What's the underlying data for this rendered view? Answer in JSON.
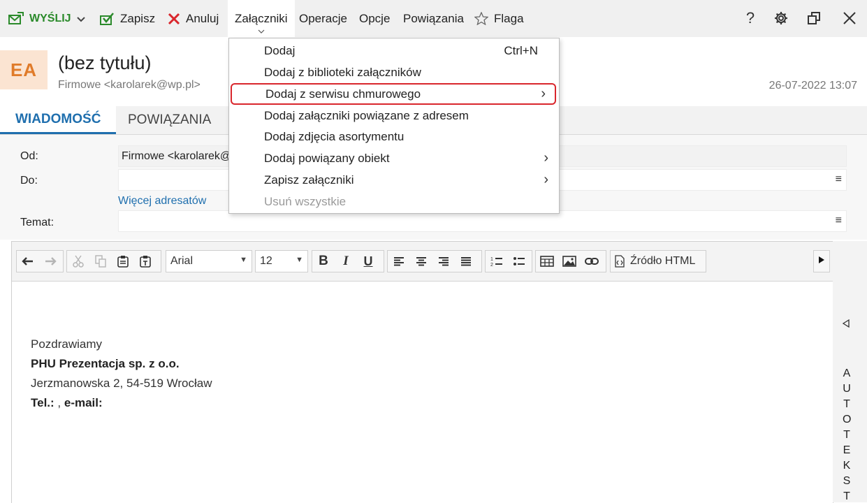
{
  "toolbar": {
    "send_label": "WYŚLIJ",
    "save_label": "Zapisz",
    "cancel_label": "Anuluj",
    "attachments_label": "Załączniki",
    "operations_label": "Operacje",
    "options_label": "Opcje",
    "relations_label": "Powiązania",
    "flag_label": "Flaga",
    "help_label": "?"
  },
  "header": {
    "avatar_initials": "EA",
    "title": "(bez tytułu)",
    "from": "Firmowe <karolarek@wp.pl>",
    "date": "26-07-2022 13:07"
  },
  "tabs": [
    {
      "label": "WIADOMOŚĆ",
      "active": true
    },
    {
      "label": "POWIĄZANIA",
      "active": false
    }
  ],
  "form": {
    "from_label": "Od:",
    "from_value": "Firmowe <karolarek@wp.pl>",
    "to_label": "Do:",
    "to_value": "",
    "more_recipients": "Więcej adresatów",
    "subject_label": "Temat:",
    "subject_value": ""
  },
  "editor": {
    "font": "Arial",
    "size": "12",
    "html_source_label": "Źródło HTML",
    "body": {
      "line1": "Pozdrawiamy",
      "line2": "PHU Prezentacja sp. z o.o.",
      "line3": "Jerzmanowska 2, 54-519 Wrocław",
      "line4_bold1": "Tel.:",
      "line4_mid": " , ",
      "line4_bold2": "e-mail:"
    }
  },
  "side_panel": {
    "letters": [
      "A",
      "U",
      "T",
      "O",
      "T",
      "E",
      "K",
      "S",
      "T"
    ]
  },
  "menu": {
    "items": [
      {
        "label": "Dodaj",
        "shortcut": "Ctrl+N",
        "submenu": false,
        "disabled": false,
        "highlighted": false
      },
      {
        "label": "Dodaj z biblioteki załączników",
        "shortcut": "",
        "submenu": false,
        "disabled": false,
        "highlighted": false
      },
      {
        "label": "Dodaj z serwisu chmurowego",
        "shortcut": "",
        "submenu": true,
        "disabled": false,
        "highlighted": true
      },
      {
        "label": "Dodaj załączniki powiązane z adresem",
        "shortcut": "",
        "submenu": false,
        "disabled": false,
        "highlighted": false
      },
      {
        "label": "Dodaj zdjęcia asortymentu",
        "shortcut": "",
        "submenu": false,
        "disabled": false,
        "highlighted": false
      },
      {
        "label": "Dodaj powiązany obiekt",
        "shortcut": "",
        "submenu": true,
        "disabled": false,
        "highlighted": false
      },
      {
        "label": "Zapisz załączniki",
        "shortcut": "",
        "submenu": true,
        "disabled": false,
        "highlighted": false
      },
      {
        "label": "Usuń wszystkie",
        "shortcut": "",
        "submenu": false,
        "disabled": true,
        "highlighted": false
      }
    ],
    "submenu_glyph": "›"
  },
  "colors": {
    "accent_blue": "#1f6fae",
    "send_green": "#2b8a2b",
    "cancel_red": "#d9262c",
    "highlight_border": "#d9262c",
    "avatar_bg": "#fbe4d2",
    "avatar_fg": "#e07b2a"
  },
  "icons": {
    "send": "envelope-arrow-icon",
    "save": "save-check-icon",
    "cancel": "x-icon",
    "flag": "star-outline-icon",
    "settings": "gear-icon",
    "restore": "restore-window-icon",
    "close": "close-icon"
  }
}
